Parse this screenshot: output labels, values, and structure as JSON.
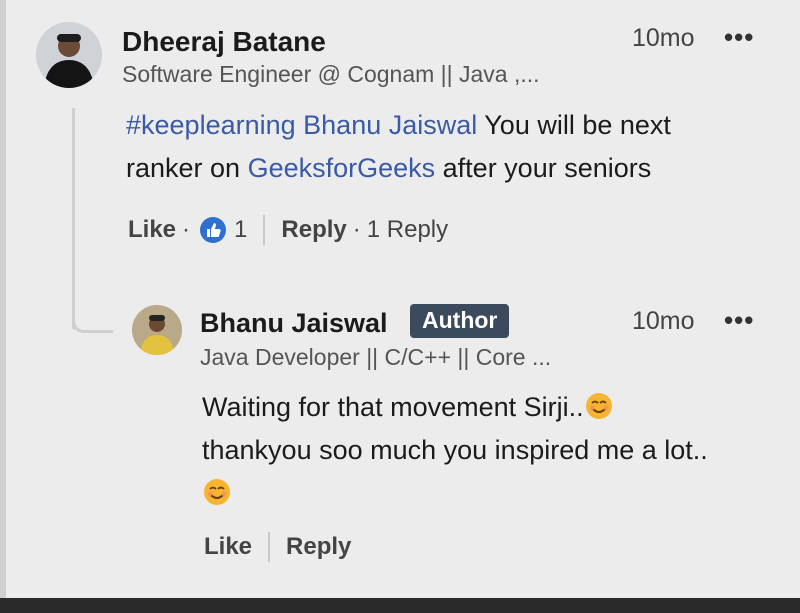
{
  "comment": {
    "author_name": "Dheeraj Batane",
    "author_headline": "Software Engineer @ Cognam || Java ,...",
    "time": "10mo",
    "more": "•••",
    "text": {
      "hashtag": "#keeplearning",
      "mention": "Bhanu Jaiswal",
      "part1": " You will be next",
      "part2": "ranker on ",
      "company": "GeeksforGeeks",
      "part3": " after your seniors"
    },
    "actions": {
      "like": "Like",
      "dot1": "·",
      "reaction_count": "1",
      "reply": "Reply",
      "dot2": "·",
      "reply_count": "1 Reply"
    }
  },
  "reply": {
    "author_name": "Bhanu Jaiswal",
    "badge": "Author",
    "author_headline": "Java Developer || C/C++ || Core ...",
    "time": "10mo",
    "more": "•••",
    "text": {
      "line1": "Waiting for that movement Sirji..",
      "line2": "thankyou soo much you inspired me a lot.."
    },
    "actions": {
      "like": "Like",
      "reply": "Reply"
    }
  },
  "colors": {
    "link": "#3a5aa6",
    "badge_bg": "#3c4a5e",
    "reaction": "#2f6fd0"
  },
  "icons": {
    "reaction": "thumbs-up-icon",
    "emoji": "smiling-face-icon",
    "more": "more-options-icon"
  }
}
